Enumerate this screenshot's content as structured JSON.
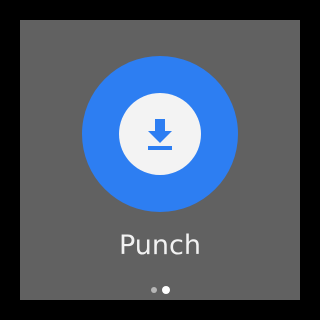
{
  "action": {
    "label": "Punch",
    "icon": "download-icon",
    "accent_color": "#2D7EF2"
  },
  "pager": {
    "page_count": 2,
    "active_index": 1
  },
  "colors": {
    "background": "#616161",
    "frame": "#000000",
    "icon_disc": "#F3F3F3"
  }
}
